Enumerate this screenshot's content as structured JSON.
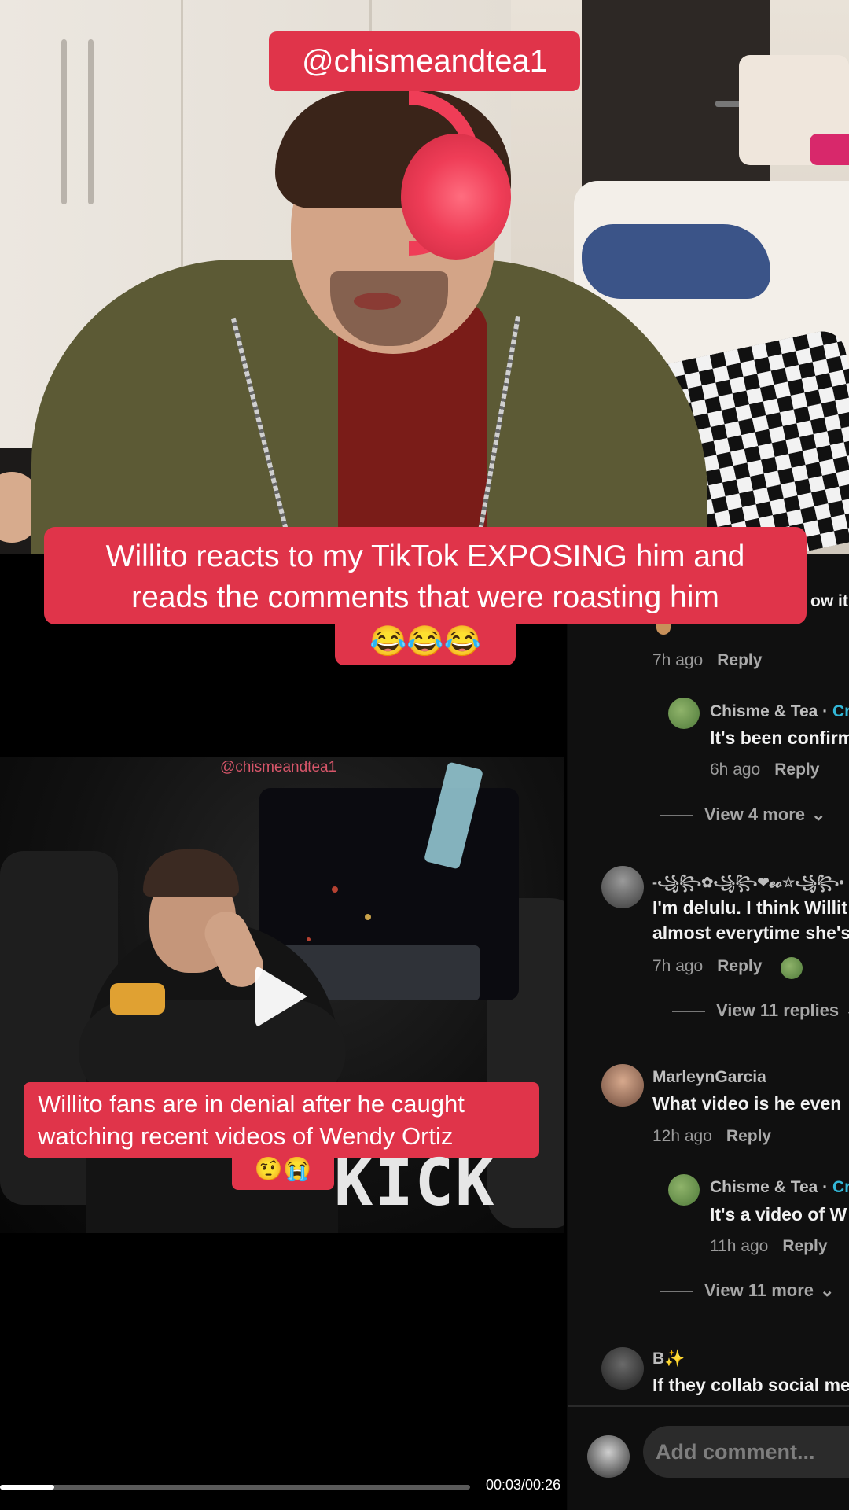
{
  "overlay": {
    "handle_badge": "@chismeandtea1",
    "caption_line1": "Willito reacts to my TikTok EXPOSING him and",
    "caption_line2": "reads the comments that were roasting him",
    "caption_emoji": "😂😂😂"
  },
  "inner_video": {
    "watermark": "@chismeandtea1",
    "caption_line1": "Willito fans are in denial after he caught",
    "caption_line2": "watching recent videos of Wendy Ortiz",
    "caption_emoji": "🤨😭",
    "logo": "KICK",
    "play_icon": "play-icon"
  },
  "player": {
    "time": "00:03/00:26",
    "progress_fraction": 0.115
  },
  "comments": {
    "items": [
      {
        "fragment": "ow it",
        "meta": "7h ago",
        "reply": "Reply"
      },
      {
        "name": "Chisme & Tea · ",
        "badge": "Cr",
        "text": "It's been confirm",
        "meta": "6h ago",
        "reply": "Reply"
      },
      {
        "view_more": "View 4 more"
      },
      {
        "name": "-꧁꧂✿꧁꧂❤𝓮𝓸☆꧁꧂•",
        "text1": "I'm delulu. I think Willit",
        "text2": "almost everytime she's",
        "meta": "7h ago",
        "reply": "Reply"
      },
      {
        "view_more": "View 11 replies"
      },
      {
        "name": "MarleynGarcia",
        "text": "What video is he even",
        "meta": "12h ago",
        "reply": "Reply"
      },
      {
        "name": "Chisme & Tea · ",
        "badge": "Cr",
        "text": "It's a video of W",
        "meta": "11h ago",
        "reply": "Reply"
      },
      {
        "view_more": "View 11 more"
      },
      {
        "name": "B✨",
        "text": "If they collab social me"
      }
    ],
    "input_placeholder": "Add comment..."
  },
  "colors": {
    "badge_red": "#e0344a",
    "creator_blue": "#32b6d6",
    "panel_bg": "#101010"
  }
}
